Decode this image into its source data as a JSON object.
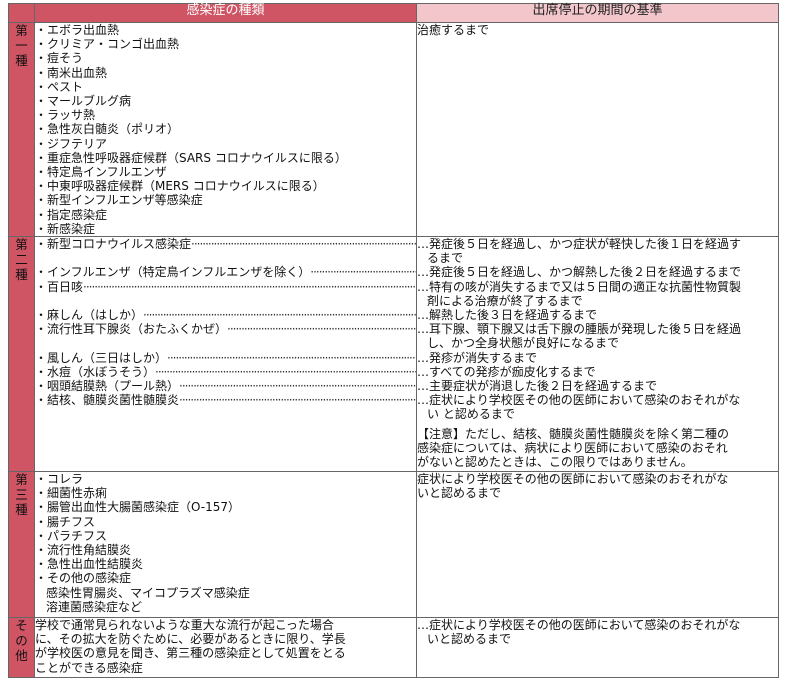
{
  "header": {
    "type_label": "感染症の種類",
    "criteria_label": "出席停止の期間の基準"
  },
  "rows": {
    "first": {
      "category": "第一種",
      "diseases": [
        "・エボラ出血熱",
        "・クリミア・コンゴ出血熱",
        "・痘そう",
        "・南米出血熱",
        "・ペスト",
        "・マールブルグ病",
        "・ラッサ熱",
        "・急性灰白髄炎（ポリオ）",
        "・ジフテリア",
        "・重症急性呼吸器症候群（SARS コロナウイルスに限る）",
        "・特定鳥インフルエンザ",
        "・中東呼吸器症候群（MERS コロナウイルスに限る）",
        "・新型インフルエンザ等感染症",
        "・指定感染症",
        "・新感染症"
      ],
      "criteria": "治癒するまで"
    },
    "second": {
      "category": "第二種",
      "entries": [
        {
          "disease": "・新型コロナウイルス感染症",
          "criteria": [
            "…発症後５日を経過し、かつ症状が軽快した後１日を経過す",
            "るまで"
          ]
        },
        {
          "disease": "・インフルエンザ（特定鳥インフルエンザを除く）",
          "criteria": [
            "…発症後５日を経過し、かつ解熱した後２日を経過するまで"
          ]
        },
        {
          "disease": "・百日咳",
          "criteria": [
            "…特有の咳が消失するまで又は５日間の適正な抗菌性物質製",
            "剤による治療が終了するまで"
          ]
        },
        {
          "disease": "・麻しん（はしか）",
          "criteria": [
            "…解熱した後３日を経過するまで"
          ]
        },
        {
          "disease": "・流行性耳下腺炎（おたふくかぜ）",
          "criteria": [
            "…耳下腺、顎下腺又は舌下腺の腫脹が発現した後５日を経過",
            "し、かつ全身状態が良好になるまで"
          ]
        },
        {
          "disease": "・風しん（三日はしか）",
          "criteria": [
            "…発疹が消失するまで"
          ]
        },
        {
          "disease": "・水痘（水ぼうそう）",
          "criteria": [
            "…すべての発疹が痂皮化するまで"
          ]
        },
        {
          "disease": "・咽頭結膜熱（プール熱）",
          "criteria": [
            "…主要症状が消退した後２日を経過するまで"
          ]
        },
        {
          "disease": "・結核、髄膜炎菌性髄膜炎",
          "criteria": [
            "…症状により学校医その他の医師において感染のおそれがな",
            "い と認めるまで"
          ]
        }
      ],
      "note": [
        "【注意】ただし、結核、髄膜炎菌性髄膜炎を除く第二種の",
        "感染症については、病状により医師において感染のおそれ",
        "がないと認めたときは、この限りではありません。"
      ]
    },
    "third": {
      "category": "第三種",
      "diseases": [
        "・コレラ",
        "・細菌性赤痢",
        "・腸管出血性大腸菌感染症（O-157）",
        "・腸チフス",
        "・パラチフス",
        "・流行性角結膜炎",
        "・急性出血性結膜炎",
        "・その他の感染症"
      ],
      "sub_diseases": [
        "感染性胃腸炎、マイコプラズマ感染症",
        "溶連菌感染症など"
      ],
      "criteria": [
        "症状により学校医その他の医師において感染のおそれがな",
        "いと認めるまで"
      ]
    },
    "other": {
      "category": "その他",
      "description": [
        "学校で通常見られないような重大な流行が起こった場合",
        "に、その拡大を防ぐために、必要があるときに限り、学長",
        "が学校医の意見を聞き、第三種の感染症として処置をとる",
        "ことができる感染症"
      ],
      "criteria": [
        "…症状により学校医その他の医師において感染のおそれがな",
        "いと認めるまで"
      ]
    }
  },
  "colors": {
    "accent": "#cf5565",
    "header_light": "#f3c6cc"
  }
}
